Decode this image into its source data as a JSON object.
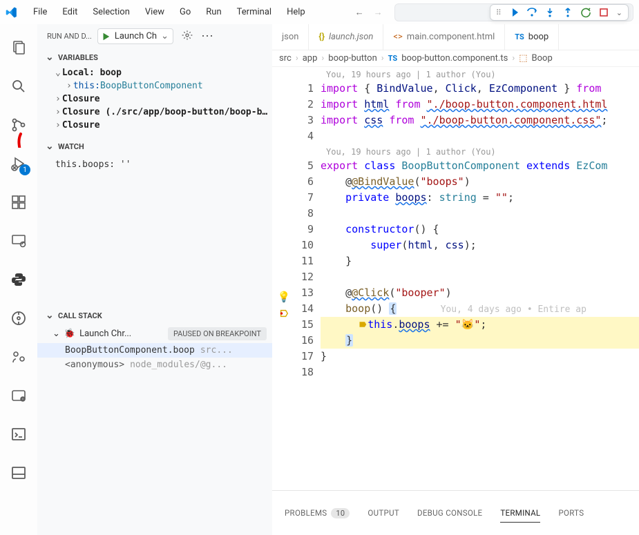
{
  "menu": [
    "File",
    "Edit",
    "Selection",
    "View",
    "Go",
    "Run",
    "Terminal",
    "Help"
  ],
  "nav": {
    "back": "←",
    "fwd": "→"
  },
  "sidebar": {
    "title": "RUN AND D...",
    "launch_label": "Launch Ch",
    "variables": {
      "title": "VARIABLES",
      "scope1": "Local: boop",
      "this_label": "this:",
      "this_type": "BoopButtonComponent",
      "closure1": "Closure",
      "closure2": "Closure (./src/app/boop-button/boop-button.",
      "closure3": "Closure"
    },
    "watch": {
      "title": "WATCH",
      "expr": "this.boops: ''"
    },
    "callstack": {
      "title": "CALL STACK",
      "session": "Launch Chr...",
      "paused": "PAUSED ON BREAKPOINT",
      "frame1": "BoopButtonComponent.boop",
      "frame1_loc": "src...",
      "frame2": "<anonymous>",
      "frame2_loc": "node_modules/@g..."
    }
  },
  "tabs": {
    "t1_suffix": "json",
    "t2": "launch.json",
    "t3": "main.component.html",
    "t4": "boop"
  },
  "breadcrumb": {
    "p1": "src",
    "p2": "app",
    "p3": "boop-button",
    "file": "boop-button.component.ts",
    "sym": "Boop"
  },
  "lens": {
    "top": "You, 19 hours ago | 1 author (You)",
    "mid": "You, 19 hours ago | 1 author (You)"
  },
  "code": {
    "l1a": "import",
    "l1b": "{ ",
    "l1c": "BindValue",
    "l1d": ", ",
    "l1e": "Click",
    "l1f": ", ",
    "l1g": "EzComponent",
    "l1h": " } ",
    "l1i": "from",
    "l2a": "import",
    "l2b": "html",
    "l2c": "from",
    "l2d": "\"./boop-button.component.html",
    "l3a": "import",
    "l3b": "css",
    "l3c": "from",
    "l3d": "\"./boop-button.component.css\"",
    "l5a": "export",
    "l5b": "class",
    "l5c": "BoopButtonComponent",
    "l5d": "extends",
    "l5e": "EzCom",
    "l6": "@BindValue",
    "l6b": "\"boops\"",
    "l7a": "private",
    "l7b": "boops",
    "l7c": ": ",
    "l7d": "string",
    "l7e": " = ",
    "l7f": "\"\"",
    "l9a": "constructor",
    "l9b": "() {",
    "l10a": "super",
    "l10b": "(",
    "l10c": "html",
    "l10d": ", ",
    "l10e": "css",
    "l10f": ");",
    "l11": "}",
    "l13a": "@Click",
    "l13b": "\"booper\"",
    "l14a": "boop",
    "l14b": "() ",
    "l14c": "{",
    "l14hint": "You, 4 days ago • Entire ap",
    "l15a": "this",
    "l15b": ".",
    "l15c": "boops",
    "l15d": " += ",
    "l15e": "\"🐱\"",
    "l16": "}",
    "l17": "}"
  },
  "panel": {
    "problems": "PROBLEMS",
    "problems_count": "10",
    "output": "OUTPUT",
    "debug": "DEBUG CONSOLE",
    "terminal": "TERMINAL",
    "ports": "PORTS"
  },
  "activity_badge": "1"
}
